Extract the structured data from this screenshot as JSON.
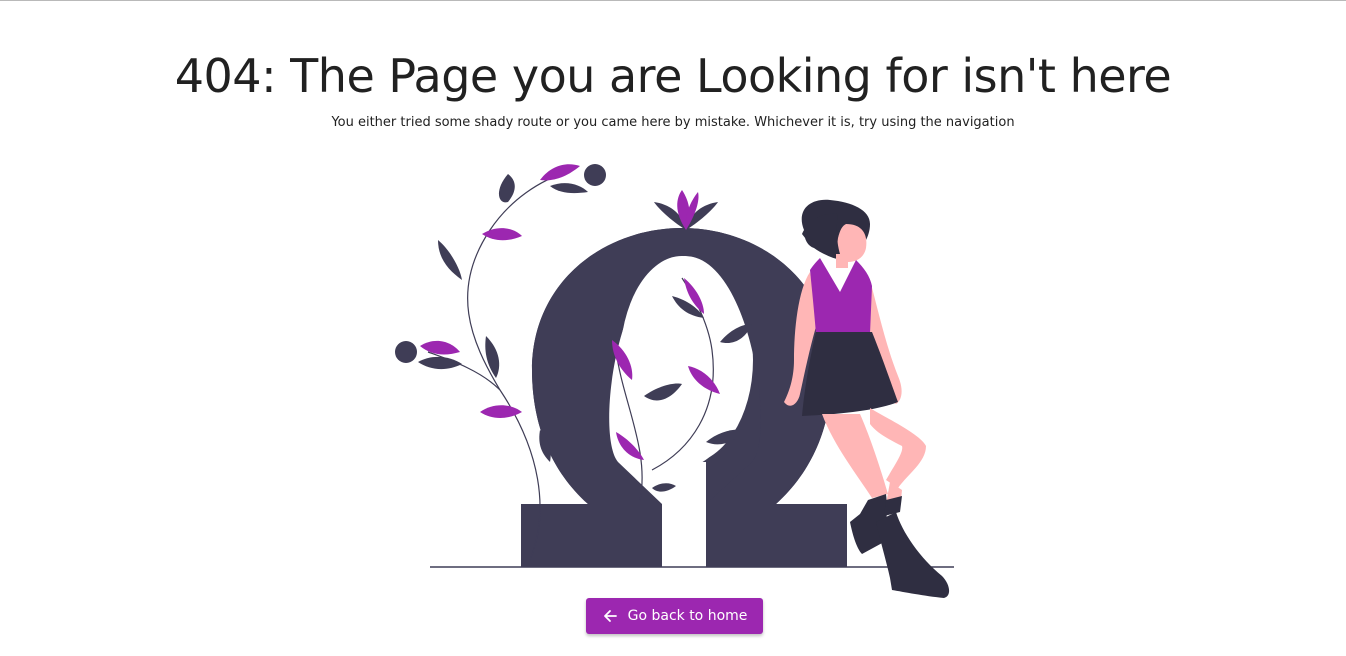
{
  "page": {
    "title": "404: The Page you are Looking for isn't here",
    "subtitle": "You either tried some shady route or you came here by mistake. Whichever it is, try using the navigation"
  },
  "illustration": {
    "subject": "woman leaning on omega symbol with vines",
    "colors": {
      "dark": "#3f3d56",
      "accent": "#9c27b0",
      "skin": "#ffb6b6",
      "hair": "#2f2e41"
    }
  },
  "actions": {
    "home_button_label": "Go back to home",
    "home_button_icon": "arrow-left-icon"
  },
  "theme": {
    "accent": "#9c27b0",
    "text": "#212121",
    "background": "#ffffff"
  }
}
